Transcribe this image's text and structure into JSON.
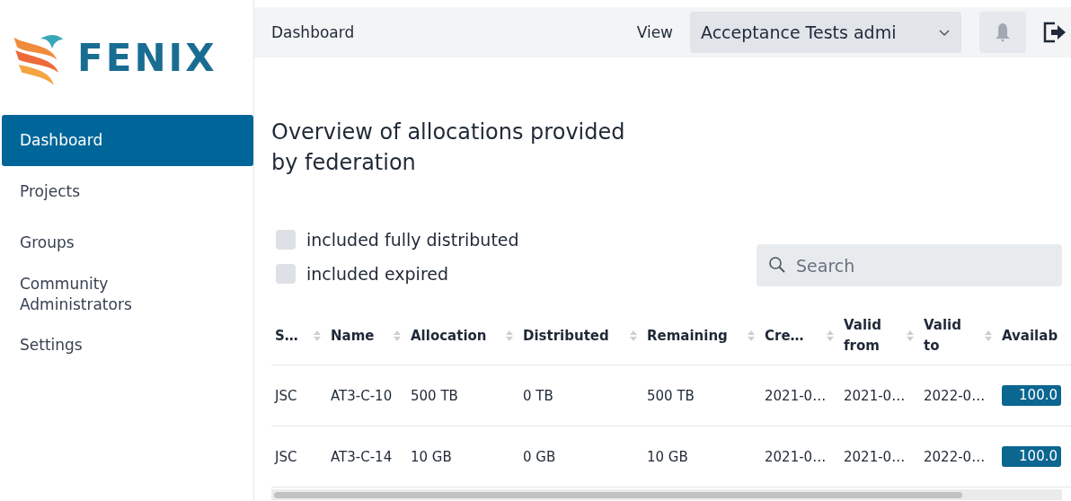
{
  "logo": {
    "text": "FENIX"
  },
  "sidebar": {
    "items": [
      {
        "label": "Dashboard",
        "selected": true
      },
      {
        "label": "Projects",
        "selected": false
      },
      {
        "label": "Groups",
        "selected": false
      },
      {
        "label": "Community Administrators",
        "selected": false
      },
      {
        "label": "Settings",
        "selected": false
      }
    ]
  },
  "header": {
    "title": "Dashboard",
    "view_label": "View",
    "view_value": "Acceptance Tests admi"
  },
  "page": {
    "title": "Overview of allocations provided by federation"
  },
  "filters": [
    {
      "label": "included fully distributed",
      "checked": false
    },
    {
      "label": "included expired",
      "checked": false
    }
  ],
  "search": {
    "placeholder": "Search"
  },
  "table": {
    "columns": [
      "S…",
      "Name",
      "Allocation",
      "Distributed",
      "Remaining",
      "Cre…",
      "Valid from",
      "Valid to",
      "Availab"
    ],
    "rows": [
      {
        "cells": [
          "JSC",
          "AT3-C-10",
          "500 TB",
          "0 TB",
          "500 TB",
          "2021-0…",
          "2021-0…",
          "2022-0…"
        ],
        "available": "100.0",
        "level": 1
      },
      {
        "cells": [
          "JSC",
          "AT3-C-14",
          "10 GB",
          "0 GB",
          "10 GB",
          "2021-0…",
          "2021-0…",
          "2022-0…"
        ],
        "available": "100.0",
        "level": 1
      }
    ]
  }
}
